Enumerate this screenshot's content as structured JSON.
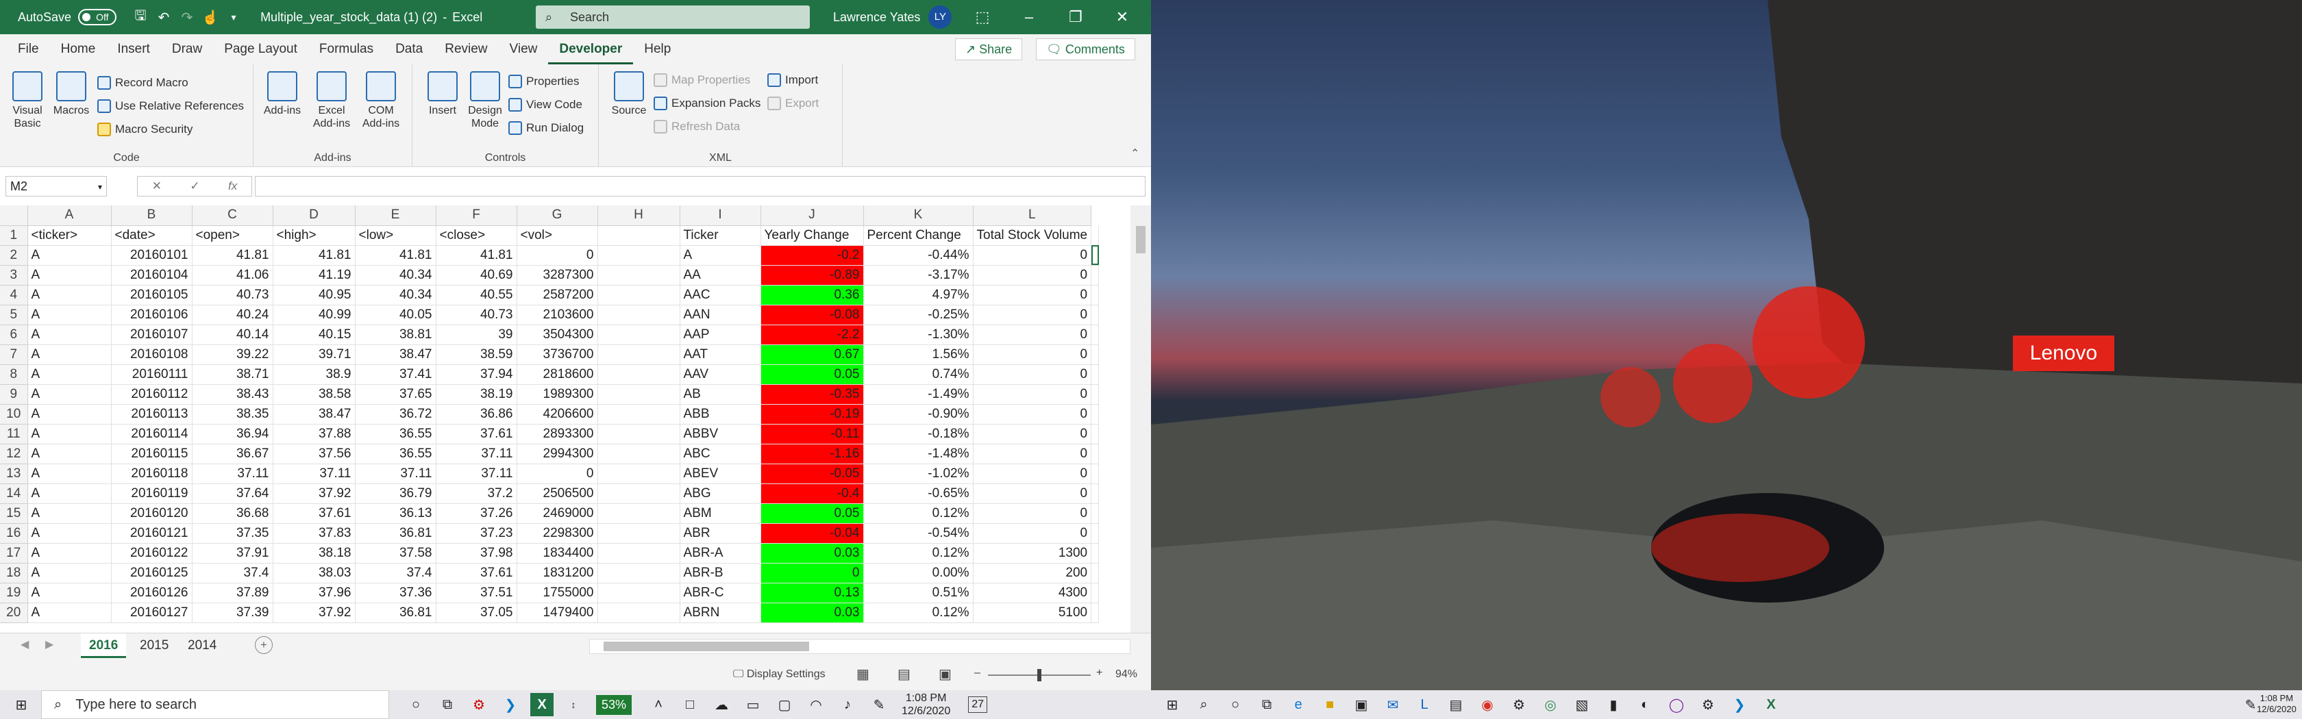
{
  "excel": {
    "autosave_label": "AutoSave",
    "autosave_state": "Off",
    "file_title": "Multiple_year_stock_data (1) (2)",
    "app_name": "Excel",
    "search_placeholder": "Search",
    "user_name": "Lawrence Yates",
    "user_initials": "LY",
    "tabs": [
      "File",
      "Home",
      "Insert",
      "Draw",
      "Page Layout",
      "Formulas",
      "Data",
      "Review",
      "View",
      "Developer",
      "Help"
    ],
    "active_tab": "Developer",
    "share_label": "Share",
    "comments_label": "Comments",
    "ribbon": {
      "code": {
        "label": "Code",
        "visual_basic": "Visual Basic",
        "macros": "Macros",
        "record_macro": "Record Macro",
        "relative_refs": "Use Relative References",
        "macro_security": "Macro Security"
      },
      "addins": {
        "label": "Add-ins",
        "addins": "Add-ins",
        "excel_addins": "Excel Add-ins",
        "com_addins": "COM Add-ins"
      },
      "controls": {
        "label": "Controls",
        "insert": "Insert",
        "design_mode": "Design Mode",
        "properties": "Properties",
        "view_code": "View Code",
        "run_dialog": "Run Dialog"
      },
      "xml": {
        "label": "XML",
        "source": "Source",
        "map_properties": "Map Properties",
        "expansion_packs": "Expansion Packs",
        "refresh_data": "Refresh Data",
        "import": "Import",
        "export": "Export"
      }
    },
    "name_box": "M2",
    "formula_icons": {
      "cancel": "✕",
      "enter": "✓",
      "fx": "fx"
    },
    "columns": [
      "A",
      "B",
      "C",
      "D",
      "E",
      "F",
      "G",
      "H",
      "I",
      "J",
      "K",
      "L"
    ],
    "header_row": [
      "<ticker>",
      "<date>",
      "<open>",
      "<high>",
      "<low>",
      "<close>",
      "<vol>",
      "",
      "Ticker",
      "Yearly Change",
      "Percent Change",
      "Total Stock Volume"
    ],
    "rows": [
      {
        "n": "2",
        "c": [
          "A",
          "20160101",
          "41.81",
          "41.81",
          "41.81",
          "41.81",
          "0",
          "",
          "A",
          "-0.2",
          "-0.44%",
          "0"
        ],
        "j": "red"
      },
      {
        "n": "3",
        "c": [
          "A",
          "20160104",
          "41.06",
          "41.19",
          "40.34",
          "40.69",
          "3287300",
          "",
          "AA",
          "-0.89",
          "-3.17%",
          "0"
        ],
        "j": "red"
      },
      {
        "n": "4",
        "c": [
          "A",
          "20160105",
          "40.73",
          "40.95",
          "40.34",
          "40.55",
          "2587200",
          "",
          "AAC",
          "0.36",
          "4.97%",
          "0"
        ],
        "j": "grn"
      },
      {
        "n": "5",
        "c": [
          "A",
          "20160106",
          "40.24",
          "40.99",
          "40.05",
          "40.73",
          "2103600",
          "",
          "AAN",
          "-0.08",
          "-0.25%",
          "0"
        ],
        "j": "red"
      },
      {
        "n": "6",
        "c": [
          "A",
          "20160107",
          "40.14",
          "40.15",
          "38.81",
          "39",
          "3504300",
          "",
          "AAP",
          "-2.2",
          "-1.30%",
          "0"
        ],
        "j": "red"
      },
      {
        "n": "7",
        "c": [
          "A",
          "20160108",
          "39.22",
          "39.71",
          "38.47",
          "38.59",
          "3736700",
          "",
          "AAT",
          "0.67",
          "1.56%",
          "0"
        ],
        "j": "grn"
      },
      {
        "n": "8",
        "c": [
          "A",
          "20160111",
          "38.71",
          "38.9",
          "37.41",
          "37.94",
          "2818600",
          "",
          "AAV",
          "0.05",
          "0.74%",
          "0"
        ],
        "j": "grn"
      },
      {
        "n": "9",
        "c": [
          "A",
          "20160112",
          "38.43",
          "38.58",
          "37.65",
          "38.19",
          "1989300",
          "",
          "AB",
          "-0.35",
          "-1.49%",
          "0"
        ],
        "j": "red"
      },
      {
        "n": "10",
        "c": [
          "A",
          "20160113",
          "38.35",
          "38.47",
          "36.72",
          "36.86",
          "4206600",
          "",
          "ABB",
          "-0.19",
          "-0.90%",
          "0"
        ],
        "j": "red"
      },
      {
        "n": "11",
        "c": [
          "A",
          "20160114",
          "36.94",
          "37.88",
          "36.55",
          "37.61",
          "2893300",
          "",
          "ABBV",
          "-0.11",
          "-0.18%",
          "0"
        ],
        "j": "red"
      },
      {
        "n": "12",
        "c": [
          "A",
          "20160115",
          "36.67",
          "37.56",
          "36.55",
          "37.11",
          "2994300",
          "",
          "ABC",
          "-1.16",
          "-1.48%",
          "0"
        ],
        "j": "red"
      },
      {
        "n": "13",
        "c": [
          "A",
          "20160118",
          "37.11",
          "37.11",
          "37.11",
          "37.11",
          "0",
          "",
          "ABEV",
          "-0.05",
          "-1.02%",
          "0"
        ],
        "j": "red"
      },
      {
        "n": "14",
        "c": [
          "A",
          "20160119",
          "37.64",
          "37.92",
          "36.79",
          "37.2",
          "2506500",
          "",
          "ABG",
          "-0.4",
          "-0.65%",
          "0"
        ],
        "j": "red"
      },
      {
        "n": "15",
        "c": [
          "A",
          "20160120",
          "36.68",
          "37.61",
          "36.13",
          "37.26",
          "2469000",
          "",
          "ABM",
          "0.05",
          "0.12%",
          "0"
        ],
        "j": "grn"
      },
      {
        "n": "16",
        "c": [
          "A",
          "20160121",
          "37.35",
          "37.83",
          "36.81",
          "37.23",
          "2298300",
          "",
          "ABR",
          "-0.04",
          "-0.54%",
          "0"
        ],
        "j": "red"
      },
      {
        "n": "17",
        "c": [
          "A",
          "20160122",
          "37.91",
          "38.18",
          "37.58",
          "37.98",
          "1834400",
          "",
          "ABR-A",
          "0.03",
          "0.12%",
          "1300"
        ],
        "j": "grn"
      },
      {
        "n": "18",
        "c": [
          "A",
          "20160125",
          "37.4",
          "38.03",
          "37.4",
          "37.61",
          "1831200",
          "",
          "ABR-B",
          "0",
          "0.00%",
          "200"
        ],
        "j": "grn"
      },
      {
        "n": "19",
        "c": [
          "A",
          "20160126",
          "37.89",
          "37.96",
          "37.36",
          "37.51",
          "1755000",
          "",
          "ABR-C",
          "0.13",
          "0.51%",
          "4300"
        ],
        "j": "grn"
      },
      {
        "n": "20",
        "c": [
          "A",
          "20160127",
          "37.39",
          "37.92",
          "36.81",
          "37.05",
          "1479400",
          "",
          "ABRN",
          "0.03",
          "0.12%",
          "5100"
        ],
        "j": "grn"
      }
    ],
    "sheets": [
      "2016",
      "2015",
      "2014"
    ],
    "active_sheet": "2016",
    "status": {
      "display_settings": "Display Settings",
      "zoom": "94%"
    }
  },
  "desktop": {
    "brand": "Lenovo"
  },
  "taskbar": {
    "search_placeholder": "Type here to search",
    "time": "1:08 PM",
    "date": "12/6/2020",
    "weather": "53%",
    "notifications": "27",
    "time2": "1:08 PM",
    "date2": "12/6/2020"
  },
  "colors": {
    "excel_green": "#217346",
    "neg": "#ff0000",
    "pos": "#00ff00",
    "lenovo_red": "#e2231a"
  }
}
